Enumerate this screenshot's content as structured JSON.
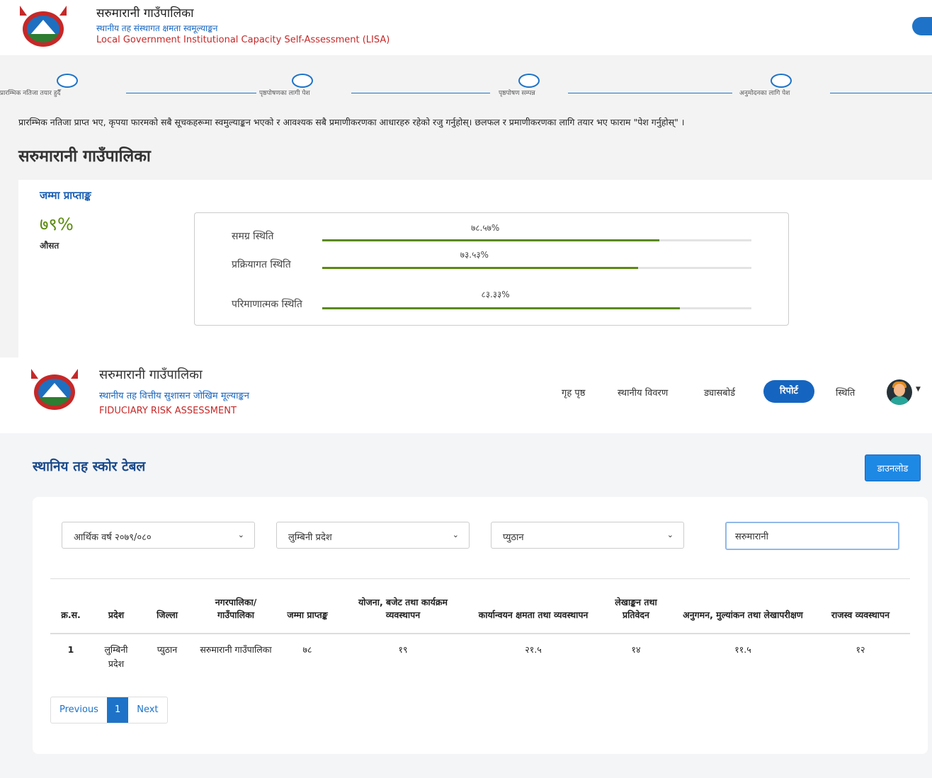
{
  "lisa": {
    "org_title": "सरुमारानी गाउँपालिका",
    "subtitle_np": "स्थानीय तह संस्थागत क्षमता स्वमूल्याङ्कन",
    "subtitle_en": "Local Government Institutional Capacity Self-Assessment (LISA)",
    "steps": [
      {
        "label": "प्रारम्भिक नतिजा तयार हुदैँ"
      },
      {
        "label": "पृष्ठपोषणका लागी पेश"
      },
      {
        "label": "पृष्ठपोषण सम्पन्न"
      },
      {
        "label": "अनुमोदनका लागि पेश"
      }
    ],
    "notice": "प्रारम्भिक नतिजा प्राप्त भए, कृपया फारमको सबै सूचकहरूमा स्वमुल्याङ्कन भएको र आवश्यक सबै प्रमाणीकरणका आधारहरु रहेको रजु गर्नुहोस्। छलफल र प्रमाणीकरणका लागि तयार भए फाराम \"पेश गर्नुहोस्\" ।",
    "municipality_heading": "सरुमारानी गाउँपालिका",
    "score_card": {
      "heading": "जम्मा प्राप्ताङ्क",
      "overall_pct": "७९%",
      "overall_label": "औसत",
      "bars": [
        {
          "label": "समग्र स्थिति",
          "value_text": "७८.५७%",
          "value": 78.57
        },
        {
          "label": "प्रक्रियागत स्थिति",
          "value_text": "७३.५३%",
          "value": 73.53
        },
        {
          "label": "परिमाणात्मक स्थिति",
          "value_text": "८३.३३%",
          "value": 83.33
        }
      ]
    }
  },
  "fra": {
    "org_title": "सरुमारानी गाउँपालिका",
    "subtitle_np": "स्थानीय तह वित्तीय सुशासन जोखिम मूल्याङ्कन",
    "subtitle_en": "FIDUCIARY RISK ASSESSMENT",
    "nav": {
      "home": "गृह पृष्ठ",
      "local_details": "स्थानीय विवरण",
      "dashboard": "ड्यासबोर्ड",
      "report": "रिपोर्ट",
      "status": "स्थिति"
    },
    "section_title": "स्थानिय तह स्कोर टेबल",
    "download_label": "डाउनलोड",
    "filters": {
      "fiscal_year": "आर्थिक वर्ष २०७९/०८०",
      "province": "लुम्बिनी प्रदेश",
      "district": "प्युठान",
      "search_value": "सरुमारानी"
    },
    "table": {
      "headers": [
        "क्र.स.",
        "प्रदेश",
        "जिल्ला",
        "नगरपालिका/ गाउँपालिका",
        "जम्मा प्राप्तङ्क",
        "योजना, बजेट तथा कार्यक्रम व्यवस्थापन",
        "कार्यान्वयन क्षमता तथा व्यवस्थापन",
        "लेखाङ्कन तथा प्रतिवेदन",
        "अनुगमन, मुल्यांकन तथा लेखापरीक्षण",
        "राजस्व व्यवस्थापन"
      ],
      "rows": [
        [
          "1",
          "लुम्बिनी प्रदेश",
          "प्युठान",
          "सरुमारानी गाउँपालिका",
          "७८",
          "१९",
          "२१.५",
          "१४",
          "११.५",
          "१२"
        ]
      ]
    },
    "pager": {
      "prev": "Previous",
      "page": "1",
      "next": "Next"
    }
  },
  "colors": {
    "primary_blue": "#1e73c8",
    "score_green": "#5b8a0e",
    "emblem_red": "#c62828"
  }
}
